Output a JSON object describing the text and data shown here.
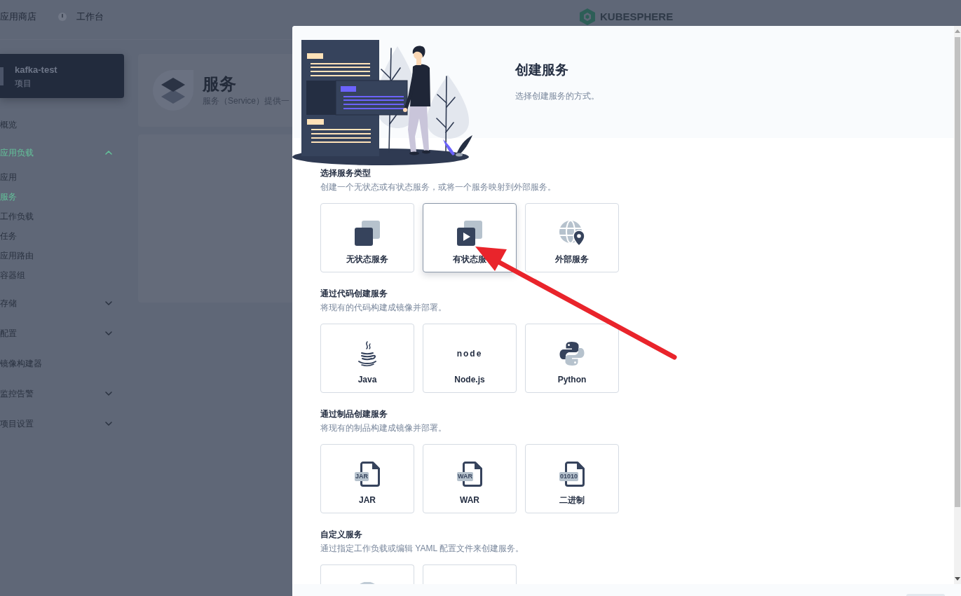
{
  "top_nav": {
    "app_store": "应用商店",
    "workbench": "工作台",
    "logo": "KUBESPHERE"
  },
  "sidebar": {
    "project": {
      "name": "kafka-test",
      "type": "项目"
    },
    "items": [
      {
        "label": "概览",
        "kind": "link",
        "selected": false
      },
      {
        "label": "应用负载",
        "kind": "group",
        "selected": true,
        "expanded": true,
        "children": [
          {
            "label": "应用",
            "selected": false
          },
          {
            "label": "服务",
            "selected": true
          },
          {
            "label": "工作负载",
            "selected": false
          },
          {
            "label": "任务",
            "selected": false
          },
          {
            "label": "应用路由",
            "selected": false
          },
          {
            "label": "容器组",
            "selected": false
          }
        ]
      },
      {
        "label": "存储",
        "kind": "group",
        "selected": false,
        "expanded": false
      },
      {
        "label": "配置",
        "kind": "group",
        "selected": false,
        "expanded": false
      },
      {
        "label": "镜像构建器",
        "kind": "link",
        "selected": false
      },
      {
        "label": "监控告警",
        "kind": "group",
        "selected": false,
        "expanded": false
      },
      {
        "label": "项目设置",
        "kind": "group",
        "selected": false,
        "expanded": false
      }
    ]
  },
  "page_header": {
    "title": "服务",
    "description": "服务（Service）提供一"
  },
  "modal": {
    "title": "创建服务",
    "description": "选择创建服务的方式。",
    "sections": [
      {
        "title": "选择服务类型",
        "description": "创建一个无状态或有状态服务，或将一个服务映射到外部服务。",
        "cards": [
          {
            "kind": "stateless",
            "label": "无状态服务",
            "selected": false
          },
          {
            "kind": "stateful",
            "label": "有状态服",
            "selected": true
          },
          {
            "kind": "external",
            "label": "外部服务",
            "selected": false
          }
        ]
      },
      {
        "title": "通过代码创建服务",
        "description": "将现有的代码构建成镜像并部署。",
        "cards": [
          {
            "kind": "java",
            "label": "Java",
            "selected": false
          },
          {
            "kind": "node",
            "label": "Node.js",
            "icon_text": "node",
            "selected": false
          },
          {
            "kind": "python",
            "label": "Python",
            "selected": false
          }
        ]
      },
      {
        "title": "通过制品创建服务",
        "description": "将现有的制品构建成镜像并部署。",
        "cards": [
          {
            "kind": "file",
            "label": "JAR",
            "icon_text": "JAR",
            "selected": false
          },
          {
            "kind": "file",
            "label": "WAR",
            "icon_text": "WAR",
            "selected": false
          },
          {
            "kind": "file",
            "label": "二进制",
            "icon_text": "01010",
            "selected": false
          }
        ]
      },
      {
        "title": "自定义服务",
        "description": "通过指定工作负载或编辑 YAML 配置文件来创建服务。",
        "cards": [
          {
            "kind": "disc",
            "selected": false
          },
          {
            "kind": "empty",
            "selected": false
          }
        ]
      }
    ]
  }
}
